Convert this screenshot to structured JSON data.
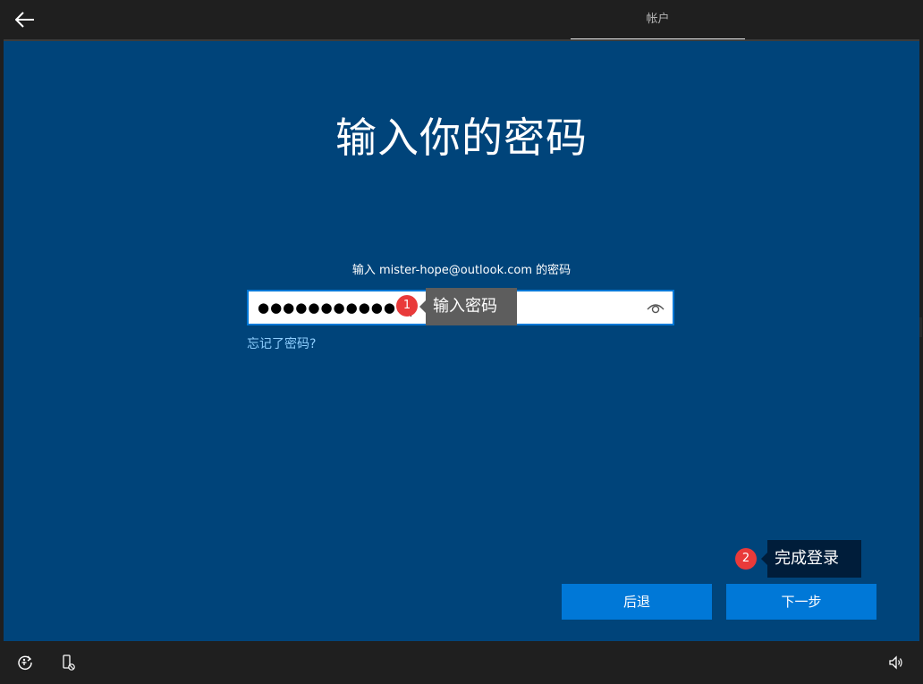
{
  "header": {
    "tab_label": "帐户"
  },
  "main": {
    "title": "输入你的密码",
    "subtitle": "输入 mister-hope@outlook.com 的密码",
    "password_value": "●●●●●●●●●●●●",
    "forgot_link": "忘记了密码?"
  },
  "annotations": [
    {
      "number": "1",
      "text": "输入密码"
    },
    {
      "number": "2",
      "text": "完成登录"
    }
  ],
  "buttons": {
    "back_label": "后退",
    "next_label": "下一步"
  },
  "colors": {
    "main_background": "#00447a",
    "accent": "#0078d7",
    "link": "#8fcfff",
    "badge": "#e93a3a",
    "chrome": "#1f1f1f"
  },
  "icons": {
    "back": "arrow-left-icon",
    "reveal_password": "eye-icon",
    "ease_of_access": "ease-of-access-icon",
    "accessibility_device": "accessibility-icon",
    "volume": "volume-icon"
  }
}
